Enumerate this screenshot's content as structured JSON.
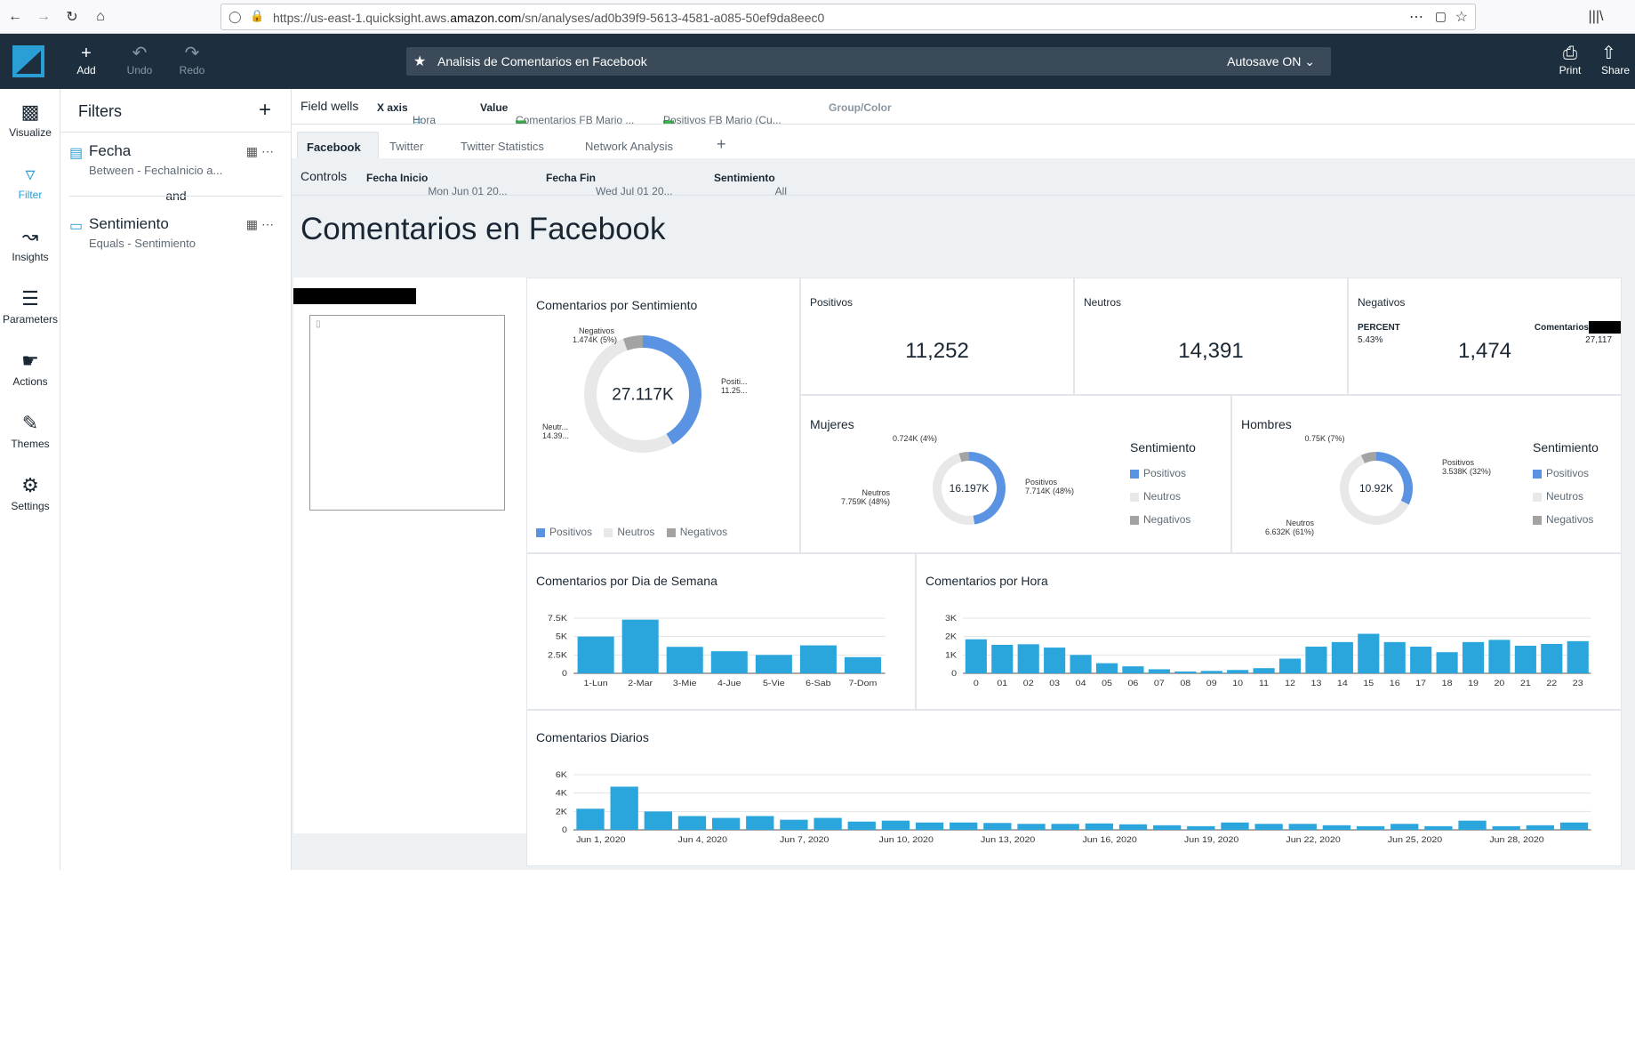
{
  "browser": {
    "url_prefix": "https://us-east-1.quicksight.aws.",
    "url_domain": "amazon.com",
    "url_rest": "/sn/analyses/ad0b39f9-5613-4581-a085-50ef9da8eec0"
  },
  "header": {
    "add_label": "Add",
    "undo_label": "Undo",
    "redo_label": "Redo",
    "analysis_title": "Analisis de Comentarios en Facebook",
    "autosave_label": "Autosave ON",
    "print_label": "Print",
    "share_label": "Share"
  },
  "rail": {
    "items": [
      {
        "label": "Visualize"
      },
      {
        "label": "Filter"
      },
      {
        "label": "Insights"
      },
      {
        "label": "Parameters"
      },
      {
        "label": "Actions"
      },
      {
        "label": "Themes"
      },
      {
        "label": "Settings"
      }
    ]
  },
  "filters": {
    "title": "Filters",
    "items": [
      {
        "name": "Fecha",
        "sub": "Between - FechaInicio a..."
      },
      {
        "name": "Sentimiento",
        "sub": "Equals - Sentimiento"
      }
    ],
    "joiner": "and"
  },
  "fieldwells": {
    "label": "Field wells",
    "xaxis_label": "X axis",
    "xaxis_value": "Hora",
    "value_label": "Value",
    "value_1": "Comentarios FB Mario ...",
    "value_2": "Positivos FB Mario (Cu...",
    "group_label": "Group/Color"
  },
  "tabs": [
    "Facebook",
    "Twitter",
    "Twitter Statistics",
    "Network Analysis"
  ],
  "controls": {
    "label": "Controls",
    "items": [
      {
        "name": "Fecha Inicio",
        "value": "Mon Jun 01 20..."
      },
      {
        "name": "Fecha Fin",
        "value": "Wed Jul 01 20..."
      },
      {
        "name": "Sentimiento",
        "value": "All"
      }
    ]
  },
  "sheet": {
    "title": "Comentarios en Facebook",
    "donut_main": {
      "title": "Comentarios por Sentimiento",
      "center": "27.117K",
      "labels": {
        "neg": "Negativos",
        "neg_val": "1.474K (5%)",
        "pos": "Positi...",
        "pos_val": "11.25...",
        "neu": "Neutr...",
        "neu_val": "14.39..."
      },
      "legend": [
        "Positivos",
        "Neutros",
        "Negativos"
      ]
    },
    "kpis": {
      "pos_title": "Positivos",
      "pos_value": "11,252",
      "neu_title": "Neutros",
      "neu_value": "14,391",
      "neg_title": "Negativos",
      "neg_value": "1,474",
      "neg_percent_label": "PERCENT",
      "neg_percent_value": "5.43%",
      "neg_total_label": "Comentarios",
      "neg_total_value": "27,117"
    },
    "mujeres": {
      "title": "Mujeres",
      "center": "16.197K",
      "neg_val": "0.724K (4%)",
      "pos": "Positivos",
      "pos_val": "7.714K (48%)",
      "neu": "Neutros",
      "neu_val": "7.759K (48%)",
      "legend_title": "Sentimiento",
      "legend": [
        "Positivos",
        "Neutros",
        "Negativos"
      ]
    },
    "hombres": {
      "title": "Hombres",
      "center": "10.92K",
      "neg_val": "0.75K (7%)",
      "pos": "Positivos",
      "pos_val": "3.538K (32%)",
      "neu": "Neutros",
      "neu_val": "6.632K (61%)",
      "legend_title": "Sentimiento",
      "legend": [
        "Positivos",
        "Neutros",
        "Negativos"
      ]
    },
    "dia_title": "Comentarios por Dia de Semana",
    "hora_title": "Comentarios por Hora",
    "diarios_title": "Comentarios Diarios"
  },
  "colors": {
    "positivos": "#5b93e3",
    "neutros": "#e8e8e8",
    "negativos": "#a3a3a3",
    "bar": "#2aa6dd",
    "header_bg": "#1d2f3e"
  },
  "chart_data": [
    {
      "type": "pie",
      "title": "Comentarios por Sentimiento",
      "categories": [
        "Positivos",
        "Neutros",
        "Negativos"
      ],
      "values": [
        11252,
        14391,
        1474
      ]
    },
    {
      "type": "pie",
      "title": "Mujeres",
      "categories": [
        "Positivos",
        "Neutros",
        "Negativos"
      ],
      "values": [
        7714,
        7759,
        724
      ]
    },
    {
      "type": "pie",
      "title": "Hombres",
      "categories": [
        "Positivos",
        "Neutros",
        "Negativos"
      ],
      "values": [
        3538,
        6632,
        750
      ]
    },
    {
      "type": "bar",
      "title": "Comentarios por Dia de Semana",
      "categories": [
        "1-Lun",
        "2-Mar",
        "3-Mie",
        "4-Jue",
        "5-Vie",
        "6-Sab",
        "7-Dom"
      ],
      "values": [
        5000,
        7300,
        3600,
        3000,
        2500,
        3800,
        2200
      ],
      "yticks": [
        "0",
        "2.5K",
        "5K",
        "7.5K"
      ],
      "ylim": [
        0,
        7500
      ]
    },
    {
      "type": "bar",
      "title": "Comentarios por Hora",
      "categories": [
        "0",
        "01",
        "02",
        "03",
        "04",
        "05",
        "06",
        "07",
        "08",
        "09",
        "10",
        "11",
        "12",
        "13",
        "14",
        "15",
        "16",
        "17",
        "18",
        "19",
        "20",
        "21",
        "22",
        "23"
      ],
      "values": [
        1850,
        1550,
        1580,
        1400,
        1000,
        550,
        380,
        220,
        100,
        130,
        180,
        280,
        800,
        1450,
        1700,
        2150,
        1700,
        1450,
        1150,
        1700,
        1820,
        1500,
        1600,
        1750
      ],
      "yticks": [
        "0",
        "1K",
        "2K",
        "3K"
      ],
      "ylim": [
        0,
        3000
      ]
    },
    {
      "type": "bar",
      "title": "Comentarios Diarios",
      "categories": [
        "Jun 1, 2020",
        "Jun 2",
        "Jun 3",
        "Jun 4, 2020",
        "Jun 5",
        "Jun 6",
        "Jun 7, 2020",
        "Jun 8",
        "Jun 9",
        "Jun 10, 2020",
        "Jun 11",
        "Jun 12",
        "Jun 13, 2020",
        "Jun 14",
        "Jun 15",
        "Jun 16, 2020",
        "Jun 17",
        "Jun 18",
        "Jun 19, 2020",
        "Jun 20",
        "Jun 21",
        "Jun 22, 2020",
        "Jun 23",
        "Jun 24",
        "Jun 25, 2020",
        "Jun 26",
        "Jun 27",
        "Jun 28, 2020",
        "Jun 29",
        "Jun 30"
      ],
      "values": [
        2300,
        4700,
        2000,
        1500,
        1300,
        1500,
        1100,
        1300,
        900,
        1000,
        800,
        800,
        750,
        650,
        650,
        700,
        600,
        500,
        400,
        800,
        650,
        650,
        500,
        400,
        650,
        400,
        1000,
        400,
        500,
        800
      ],
      "xtick_labels": [
        "Jun 1, 2020",
        "Jun 4, 2020",
        "Jun 7, 2020",
        "Jun 10, 2020",
        "Jun 13, 2020",
        "Jun 16, 2020",
        "Jun 19, 2020",
        "Jun 22, 2020",
        "Jun 25, 2020",
        "Jun 28, 2020"
      ],
      "yticks": [
        "0",
        "2K",
        "4K",
        "6K"
      ],
      "ylim": [
        0,
        6000
      ]
    }
  ]
}
